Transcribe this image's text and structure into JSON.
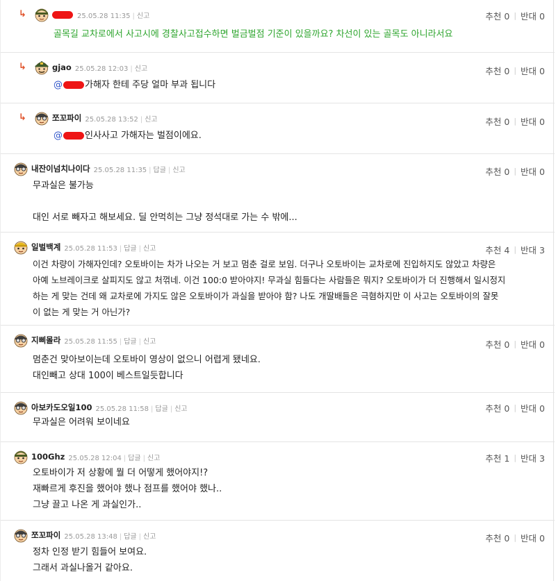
{
  "vote_labels": {
    "up": "추천",
    "down": "반대"
  },
  "action_labels": {
    "reply": "답글",
    "report": "신고"
  },
  "comments": [
    {
      "nick": "",
      "date": "25.05.28 11:35",
      "up": "0",
      "down": "0",
      "text": "골목길 교차로에서 사고시에 경찰사고접수하면 벌금벌점 기준이 있을까요? 차선이 있는 골목도 아니라서요"
    },
    {
      "nick": "gjao",
      "date": "25.05.28 12:03",
      "up": "0",
      "down": "0",
      "mention": "@",
      "text": "가해자 한테 주당 얼마 부과 됩니다"
    },
    {
      "nick": "쪼꼬파이",
      "date": "25.05.28 13:52",
      "up": "0",
      "down": "0",
      "mention": "@",
      "text": "인사사고 가해자는 벌점이에요."
    },
    {
      "nick": "내잔이넘치나이다",
      "date": "25.05.28 11:35",
      "up": "0",
      "down": "0",
      "lines": [
        "무과실은 불가능",
        "",
        "대인 서로 빼자고 해보세요. 딜 안먹히는 그냥 정석대로 가는 수 밖에..."
      ]
    },
    {
      "nick": "일벌백계",
      "date": "25.05.28 11:53",
      "up": "4",
      "down": "3",
      "lines": [
        "이건 차량이 가해자인데? 오토바이는 차가 나오는 거 보고 멈춘 걸로 보임. 더구나 오토바이는 교차로에 진입하지도 않았고 차량은",
        "아예 노브레이크로 살피지도 않고 처꺾네. 이건 100:0 받아야지! 무과실 힘들다는 사람들은 뭐지? 오토바이가 더 진행해서 일시정지",
        "하는 게 맞는 건데 왜 교차로에 가지도 않은 오토바이가 과실을 받아야 함? 나도 개딸배들은 극혐하지만 이 사고는 오토바이의 잘못",
        "이 없는 게 맞는 거 아닌가?"
      ]
    },
    {
      "nick": "지삐몰라",
      "date": "25.05.28 11:55",
      "up": "0",
      "down": "0",
      "lines": [
        "멈춘건 맞아보이는데 오토바이 영상이 없으니 어렵게 됐네요.",
        "대인빼고 상대 100이 베스트일듯합니다"
      ]
    },
    {
      "nick": "아보카도오일100",
      "date": "25.05.28 11:58",
      "up": "0",
      "down": "0",
      "lines": [
        "무과실은 어려워 보이네요"
      ]
    },
    {
      "nick": "100Ghz",
      "date": "25.05.28 12:04",
      "up": "1",
      "down": "3",
      "lines": [
        "오토바이가 저 상황에 뭘 더 어떻게 했어야지!?",
        "재빠르게 후진을 했어야 했나 점프를 했어야 했나..",
        "그냥 끌고 나온 게 과실인가.."
      ]
    },
    {
      "nick": "쪼꼬파이",
      "date": "25.05.28 13:48",
      "up": "0",
      "down": "0",
      "lines": [
        "정차 인정 받기 힘들어 보여요.",
        "그래서 과실나올거 같아요."
      ]
    }
  ]
}
